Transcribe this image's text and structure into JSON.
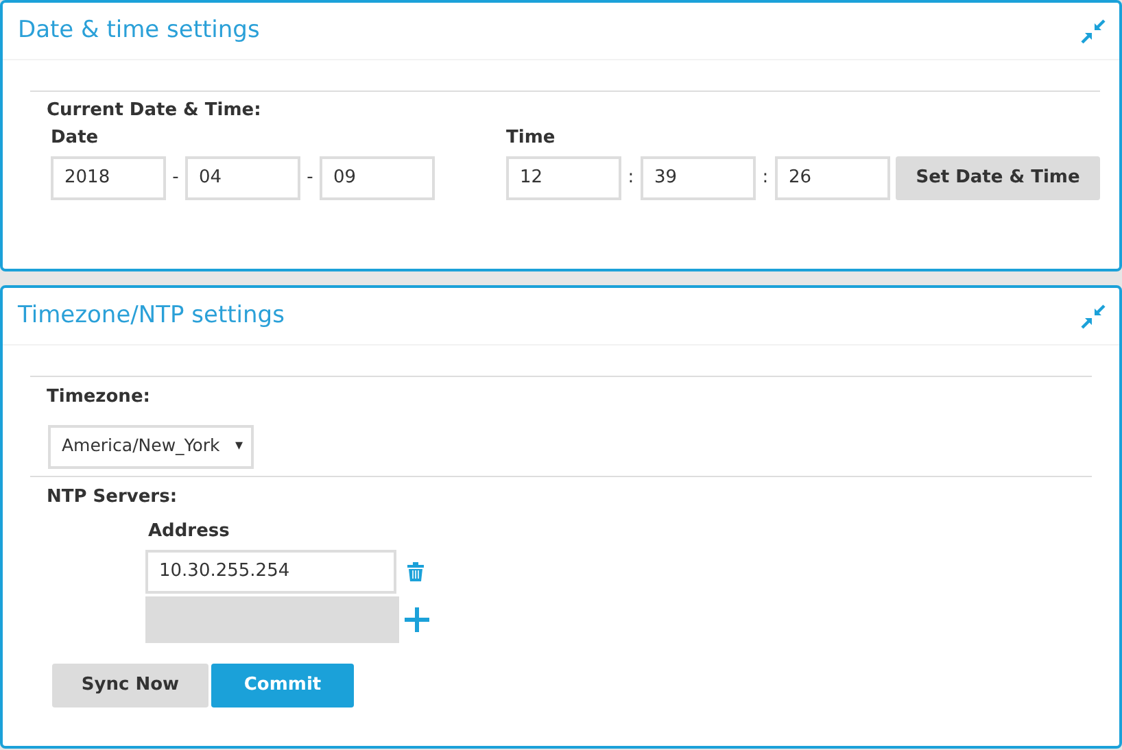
{
  "panels": [
    {
      "title": "Date & time settings"
    },
    {
      "title": "Timezone/NTP settings"
    }
  ],
  "datetime": {
    "heading": "Current Date & Time:",
    "date_label": "Date",
    "date_values": [
      "2018",
      "04",
      "09"
    ],
    "date_separators": [
      "-",
      "-"
    ],
    "time_label": "Time",
    "time_values": [
      "12",
      "39",
      "26"
    ],
    "time_separators": [
      ":",
      ":"
    ],
    "button": "Set Date & Time"
  },
  "timezone": {
    "label": "Timezone:",
    "value": "America/New_York",
    "caret": "▾"
  },
  "ntp": {
    "label": "NTP Servers:",
    "column": "Address",
    "servers": [
      "10.30.255.254"
    ]
  },
  "buttons": [
    {
      "label": "Sync Now",
      "kind": "secondary"
    },
    {
      "label": "Commit",
      "kind": "primary"
    }
  ]
}
